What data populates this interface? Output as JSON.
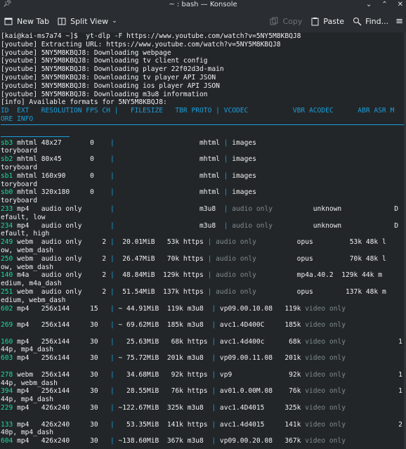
{
  "window": {
    "title": "~ : bash — Konsole"
  },
  "toolbar": {
    "new_tab": "New Tab",
    "split_view": "Split View",
    "copy": "Copy",
    "paste": "Paste",
    "find": "Find..."
  },
  "terminal": {
    "lines": [
      "[kai@kai-ms7a74 ~]$  yt-dlp -F https://www.youtube.com/watch?v=5NY5M8KBQJ8",
      "[youtube] Extracting URL: https://www.youtube.com/watch?v=5NY5M8KBQJ8",
      "[youtube] 5NY5M8KBQJ8: Downloading webpage",
      "[youtube] 5NY5M8KBQJ8: Downloading tv client config",
      "[youtube] 5NY5M8KBQJ8: Downloading player 22f02d3d-main",
      "[youtube] 5NY5M8KBQJ8: Downloading tv player API JSON",
      "[youtube] 5NY5M8KBQJ8: Downloading ios player API JSON",
      "[youtube] 5NY5M8KBQJ8: Downloading m3u8 information",
      "[info] Available formats for 5NY5M8KBQJ8:"
    ],
    "header1": "ID  EXT   RESOLUTION FPS CH |   FILESIZE   TBR PROTO | VCODEC           VBR ACODEC      ABR ASR M",
    "header2": "ORE INFO",
    "rows": [
      {
        "id": "sb3",
        "a": " mhtml 48x27       0    ",
        "b": "                     mhtml ",
        "c": "images",
        "d": "                                       s",
        "wrap": "toryboard"
      },
      {
        "id": "sb2",
        "a": " mhtml 80x45       0    ",
        "b": "                     mhtml ",
        "c": "images",
        "d": "                                       s",
        "wrap": "toryboard"
      },
      {
        "id": "sb1",
        "a": " mhtml 160x90      0    ",
        "b": "                     mhtml ",
        "c": "images",
        "d": "                                       s",
        "wrap": "toryboard"
      },
      {
        "id": "sb0",
        "a": " mhtml 320x180     0    ",
        "b": "                     mhtml ",
        "c": "images",
        "d": "                                       s",
        "wrap": "toryboard"
      },
      {
        "id": "233",
        "a": " mp4   audio only       ",
        "b": "                     m3u8  ",
        "c": "audio only",
        "d": "          unknown             D",
        "wrap": "efault, low"
      },
      {
        "id": "234",
        "a": " mp4   audio only       ",
        "b": "                     m3u8  ",
        "c": "audio only",
        "d": "          unknown             D",
        "wrap": "efault, high"
      },
      {
        "id": "249",
        "a": " webm  audio only     2 ",
        "b": "  20.01MiB   53k https ",
        "c": "audio only",
        "d": "          opus         53k 48k l",
        "wrap": "ow, webm_dash"
      },
      {
        "id": "250",
        "a": " webm  audio only     2 ",
        "b": "  26.47MiB   70k https ",
        "c": "audio only",
        "d": "          opus         70k 48k l",
        "wrap": "ow, webm_dash"
      },
      {
        "id": "140",
        "a": " m4a   audio only     2 ",
        "b": "  48.84MiB  129k https ",
        "c": "audio only",
        "d": "          mp4a.40.2  129k 44k m",
        "wrap": "edium, m4a_dash"
      },
      {
        "id": "251",
        "a": " webm  audio only     2 ",
        "b": "  51.54MiB  137k https ",
        "c": "audio only",
        "d": "          opus        137k 48k m",
        "wrap": "edium, webm_dash"
      },
      {
        "id": "602",
        "a": " mp4   256x144     15   ",
        "b": " ~ 44.91MiB  119k m3u8  ",
        "c": "vp09.00.10.08   119k ",
        "d": "video only",
        "wrap": ""
      },
      {
        "id": "269",
        "a": " mp4   256x144     30   ",
        "b": " ~ 69.62MiB  185k m3u8  ",
        "c": "avc1.4D400C     185k ",
        "d": "video only",
        "wrap": ""
      },
      {
        "id": "160",
        "a": " mp4   256x144     30   ",
        "b": "   25.63MiB   68k https ",
        "c": "avc1.4d400c      68k ",
        "d": "video only             1",
        "wrap": "44p, mp4_dash"
      },
      {
        "id": "603",
        "a": " mp4   256x144     30   ",
        "b": " ~ 75.72MiB  201k m3u8  ",
        "c": "vp09.00.11.08   201k ",
        "d": "video only",
        "wrap": ""
      },
      {
        "id": "278",
        "a": " webm  256x144     30   ",
        "b": "   34.68MiB   92k https ",
        "c": "vp9              92k ",
        "d": "video only             1",
        "wrap": "44p, webm_dash"
      },
      {
        "id": "394",
        "a": " mp4   256x144     30   ",
        "b": "   28.55MiB   76k https ",
        "c": "av01.0.00M.08    76k ",
        "d": "video only             1",
        "wrap": "44p, mp4_dash"
      },
      {
        "id": "229",
        "a": " mp4   426x240     30   ",
        "b": " ~122.67MiB  325k m3u8  ",
        "c": "avc1.4D4015     325k ",
        "d": "video only",
        "wrap": ""
      },
      {
        "id": "133",
        "a": " mp4   426x240     30   ",
        "b": "   53.35MiB  141k https ",
        "c": "avc1.4d4015     141k ",
        "d": "video only             2",
        "wrap": "40p, mp4_dash"
      },
      {
        "id": "604",
        "a": " mp4   426x240     30   ",
        "b": " ~138.60MiB  367k m3u8  ",
        "c": "vp09.00.20.08   367k ",
        "d": "video only",
        "wrap": ""
      }
    ]
  }
}
